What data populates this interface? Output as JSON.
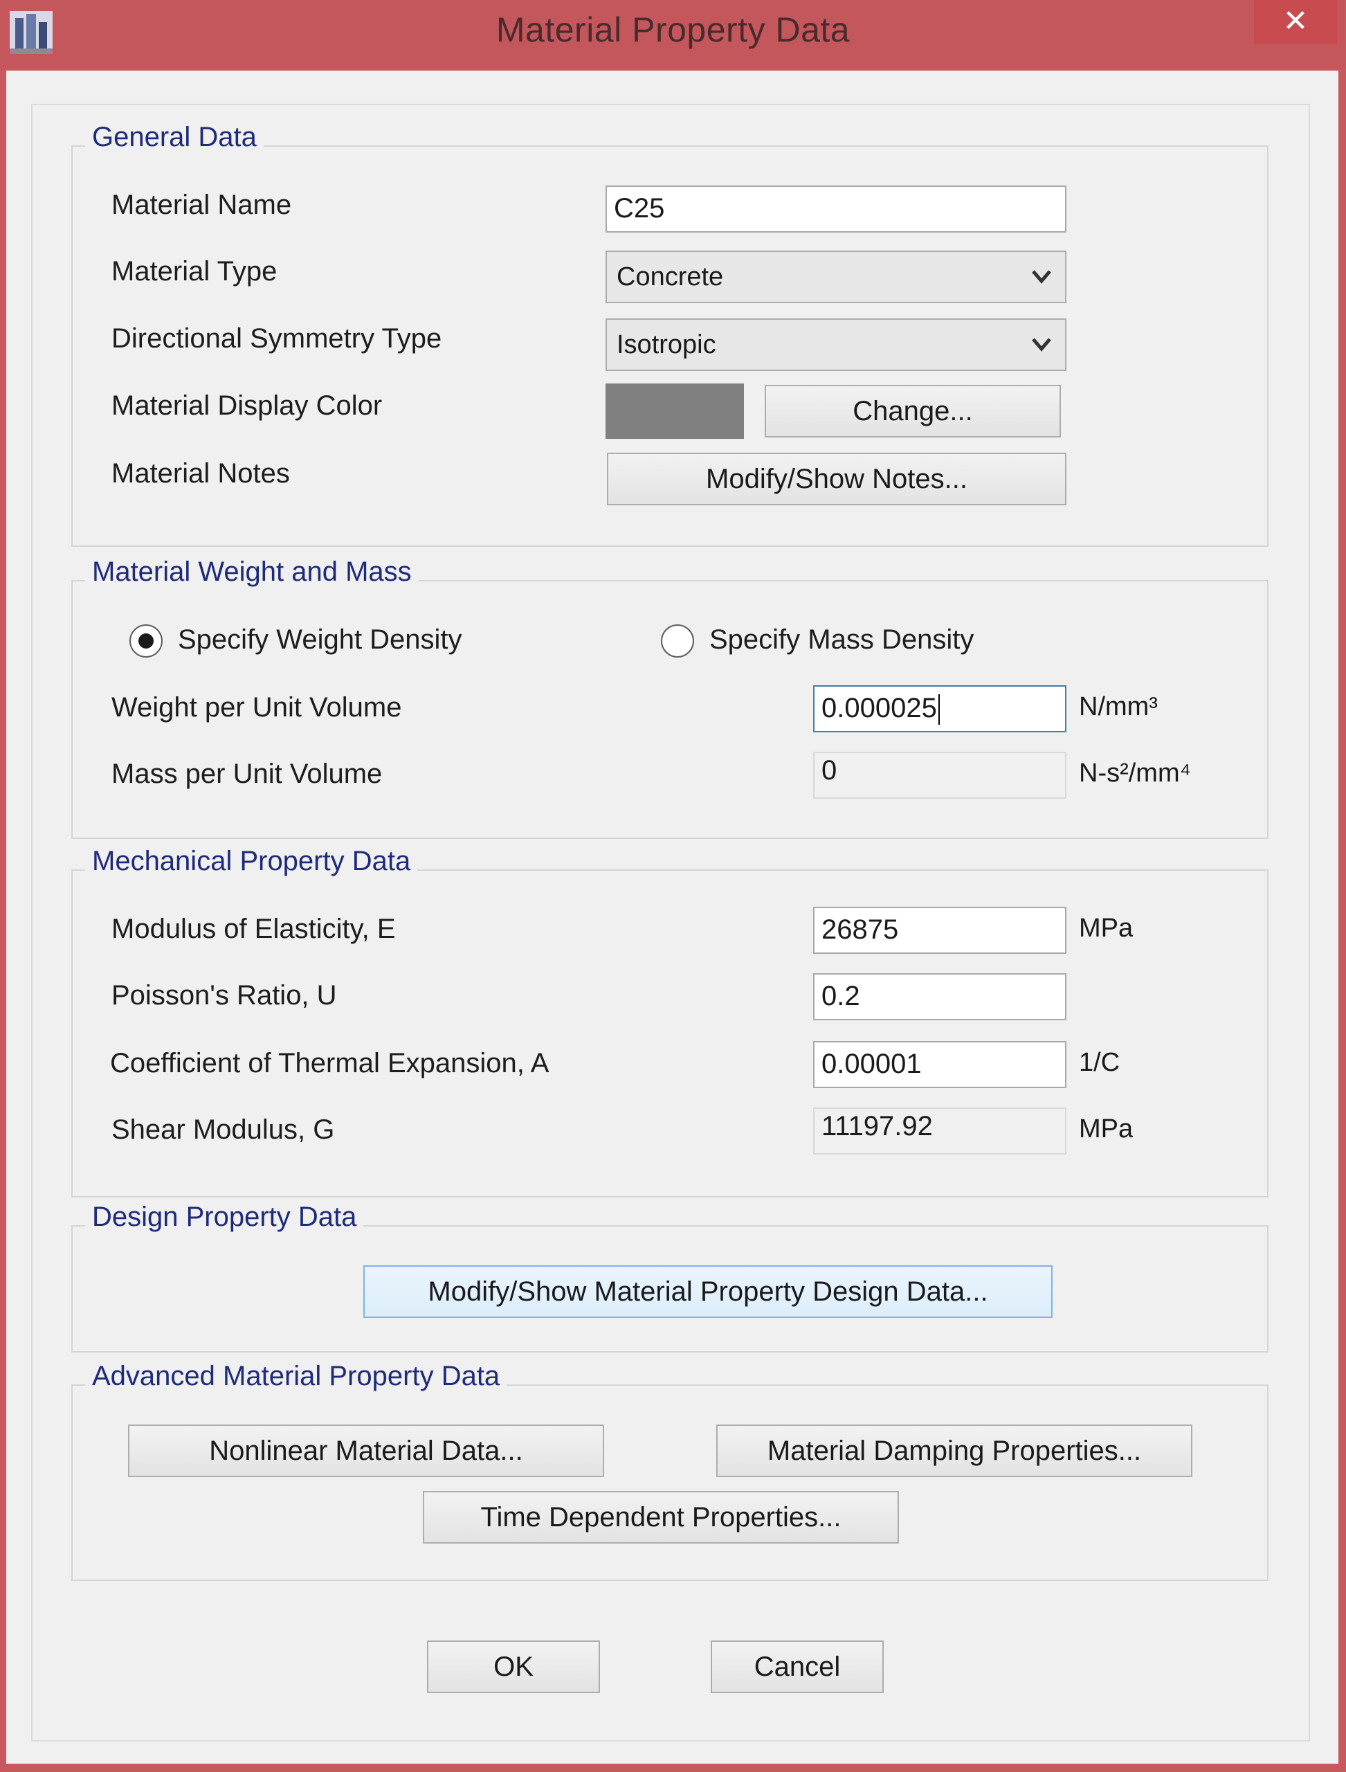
{
  "window": {
    "title": "Material Property Data",
    "close_glyph": "✕"
  },
  "general": {
    "title": "General Data",
    "material_name_label": "Material Name",
    "material_name_value": "C25",
    "material_type_label": "Material Type",
    "material_type_value": "Concrete",
    "symmetry_label": "Directional Symmetry Type",
    "symmetry_value": "Isotropic",
    "display_color_label": "Material Display Color",
    "display_color": "#808080",
    "change_label": "Change...",
    "notes_label": "Material Notes",
    "notes_button": "Modify/Show Notes..."
  },
  "weight_mass": {
    "title": "Material Weight and Mass",
    "radio_weight_label": "Specify Weight Density",
    "radio_mass_label": "Specify Mass Density",
    "selected": "weight",
    "weight_label": "Weight per Unit Volume",
    "weight_value": "0.000025",
    "weight_unit": "N/mm³",
    "mass_label": "Mass per Unit Volume",
    "mass_value": "0",
    "mass_unit": "N-s²/mm⁴"
  },
  "mechanical": {
    "title": "Mechanical Property Data",
    "e_label": "Modulus of Elasticity,  E",
    "e_value": "26875",
    "e_unit": "MPa",
    "u_label": "Poisson's Ratio,  U",
    "u_value": "0.2",
    "a_label": "Coefficient of Thermal Expansion,  A",
    "a_value": "0.00001",
    "a_unit": "1/C",
    "g_label": "Shear Modulus,  G",
    "g_value": "11197.92",
    "g_unit": "MPa"
  },
  "design": {
    "title": "Design Property Data",
    "button": "Modify/Show Material Property Design Data..."
  },
  "advanced": {
    "title": "Advanced Material Property Data",
    "nonlinear_button": "Nonlinear Material Data...",
    "damping_button": "Material Damping Properties...",
    "time_button": "Time Dependent Properties..."
  },
  "footer": {
    "ok": "OK",
    "cancel": "Cancel"
  },
  "icons": {
    "app": "etabs-building-icon",
    "dropdown": "chevron-down-icon",
    "close": "close-icon"
  }
}
